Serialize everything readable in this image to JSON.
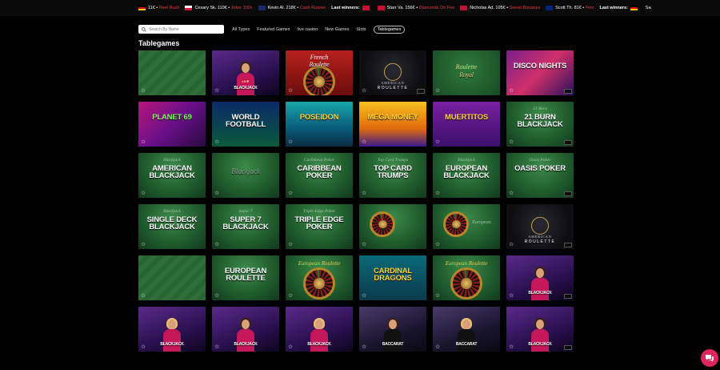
{
  "ticker": {
    "label": "Last winners:",
    "items": [
      {
        "pre": "11€ • ",
        "game": "Reel Rush",
        "flag": "de"
      },
      {
        "pre": "Cesary Sk. 110€ • ",
        "game": "Joker 100x",
        "flag": "pl"
      },
      {
        "pre": "Kevin Al. 218€ • ",
        "game": "Cash Runner",
        "flag": "nz"
      },
      {
        "lw": true,
        "pre": "",
        "game": "",
        "flag": "gb"
      },
      {
        "pre": "Starr Va. 156€ • ",
        "game": "Diamonds On Fire",
        "flag": "gb"
      },
      {
        "pre": "Nicholas Ad. 105€ • ",
        "game": "Sweet Bonanza",
        "flag": "gb"
      },
      {
        "pre": "Scott Th. 81€ • ",
        "game": "Finn",
        "flag": "au"
      },
      {
        "lw": true,
        "pre": "",
        "game": "",
        "flag": "de"
      },
      {
        "pre": "Sa",
        "game": "",
        "flag": ""
      }
    ]
  },
  "search": {
    "placeholder": "Search By Name"
  },
  "tabs": [
    {
      "label": "All Types",
      "active": false
    },
    {
      "label": "Featured Games",
      "active": false
    },
    {
      "label": "live casino",
      "active": false
    },
    {
      "label": "New Games",
      "active": false
    },
    {
      "label": "Slots",
      "active": false
    },
    {
      "label": "Tablegames",
      "active": true
    }
  ],
  "section_title": "Tablegames",
  "colors": {
    "accent_red": "#e63a3a",
    "chat": "#e0245e",
    "felt": "#1e5a2c"
  },
  "games": [
    {
      "t1": "",
      "t2": "",
      "art": "felt-lines",
      "name": "baccarat-table"
    },
    {
      "t1": "",
      "t2": "BLACKJACK",
      "art": "live-purple",
      "name": "blackjack-live"
    },
    {
      "t1": "French",
      "t2": "Roulette",
      "art": "french-roulette",
      "name": "french-roulette"
    },
    {
      "t1": "AMERICAN",
      "t2": "ROULETTE",
      "art": "american-dark",
      "name": "american-roulette"
    },
    {
      "t1": "Roulette",
      "t2": "Royal",
      "art": "roulette-royal",
      "name": "roulette-royal"
    },
    {
      "t1": "",
      "t2": "DISCO NIGHTS",
      "art": "disco",
      "name": "disco-nights"
    },
    {
      "t1": "",
      "t2": "PLANET 69",
      "art": "planet",
      "name": "planet-69"
    },
    {
      "t1": "",
      "t2": "WORLD FOOTBALL",
      "art": "football",
      "name": "world-football"
    },
    {
      "t1": "",
      "t2": "POSEIDON",
      "art": "poseidon",
      "name": "gold-of-poseidon"
    },
    {
      "t1": "",
      "t2": "MEGA MONEY",
      "art": "mega",
      "name": "mega-money"
    },
    {
      "t1": "",
      "t2": "MUERTITOS",
      "art": "muertitos",
      "name": "muertitos"
    },
    {
      "t1": "21 Burn",
      "t2": "21 BURN BLACKJACK",
      "art": "felt",
      "name": "21-burn-blackjack"
    },
    {
      "t1": "Blackjack",
      "t2": "AMERICAN BLACKJACK",
      "art": "felt",
      "name": "american-blackjack"
    },
    {
      "t1": "",
      "t2": "Blackjack",
      "art": "felt-table",
      "name": "blackjack-table"
    },
    {
      "t1": "Caribbean Poker",
      "t2": "CARIBBEAN POKER",
      "art": "felt",
      "name": "caribbean-poker"
    },
    {
      "t1": "Top Card Trumps",
      "t2": "TOP CARD TRUMPS",
      "art": "felt",
      "name": "top-card-trumps"
    },
    {
      "t1": "Blackjack",
      "t2": "EUROPEAN BLACKJACK",
      "art": "felt",
      "name": "european-blackjack"
    },
    {
      "t1": "Oasis Poker",
      "t2": "OASIS POKER",
      "art": "felt",
      "name": "oasis-poker"
    },
    {
      "t1": "Blackjack",
      "t2": "SINGLE DECK BLACKJACK",
      "art": "felt",
      "name": "single-deck-blackjack"
    },
    {
      "t1": "Super 7",
      "t2": "SUPER 7 BLACKJACK",
      "art": "felt",
      "name": "super-7-blackjack"
    },
    {
      "t1": "Triple Edge Poker",
      "t2": "TRIPLE EDGE POKER",
      "art": "felt",
      "name": "triple-edge-poker"
    },
    {
      "t1": "",
      "t2": "",
      "art": "roulette-table",
      "name": "american-roulette-table"
    },
    {
      "t1": "European",
      "t2": "",
      "art": "roulette-table",
      "name": "european-roulette-table"
    },
    {
      "t1": "AMERICAN",
      "t2": "ROULETTE",
      "art": "american-dark",
      "name": "american-roulette-2"
    },
    {
      "t1": "",
      "t2": "",
      "art": "felt-lines",
      "name": "baccarat-table-2"
    },
    {
      "t1": "",
      "t2": "EUROPEAN ROULETTE",
      "art": "felt",
      "name": "european-roulette"
    },
    {
      "t1": "European Roulette",
      "t2": "",
      "art": "wheel-felt",
      "name": "european-roulette-wheel"
    },
    {
      "t1": "",
      "t2": "CARDINAL DRAGONS",
      "art": "dragons",
      "name": "cardinal-dragons"
    },
    {
      "t1": "European Roulette",
      "t2": "",
      "art": "wheel-felt",
      "name": "european-roulette-2"
    },
    {
      "t1": "",
      "t2": "BLACKJACK",
      "art": "live-purple",
      "name": "live-blackjack-1"
    },
    {
      "t1": "",
      "t2": "BLACKJACK",
      "art": "live-purple",
      "name": "live-blackjack-2"
    },
    {
      "t1": "",
      "t2": "BLACKJACK",
      "art": "live-purple",
      "name": "live-blackjack-3"
    },
    {
      "t1": "",
      "t2": "BLACKJACK",
      "art": "live-purple",
      "name": "live-blackjack-4"
    },
    {
      "t1": "",
      "t2": "BACCARAT",
      "art": "live-dark",
      "name": "live-baccarat-1"
    },
    {
      "t1": "",
      "t2": "BACCARAT",
      "art": "live-dark",
      "name": "live-baccarat-2"
    },
    {
      "t1": "",
      "t2": "BLACKJACK",
      "art": "live-purple",
      "name": "live-blackjack-5"
    }
  ]
}
